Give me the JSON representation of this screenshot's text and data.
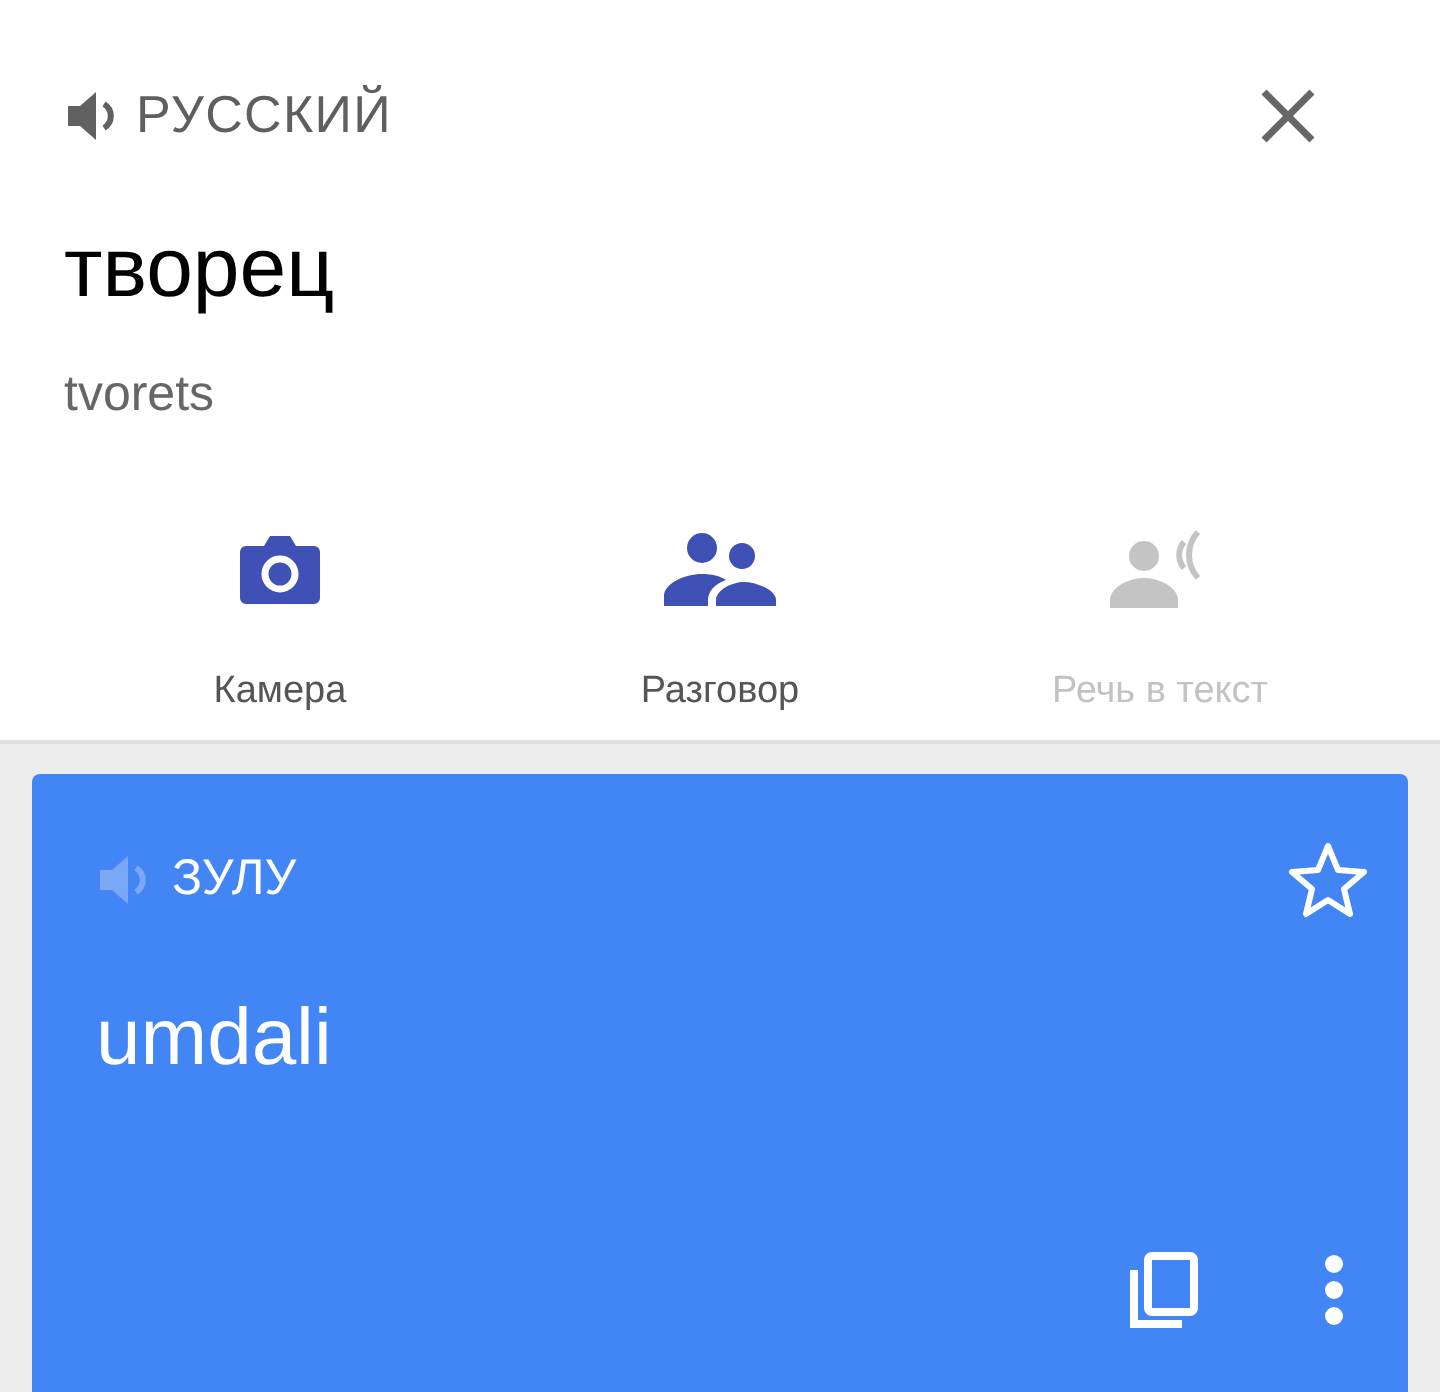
{
  "source": {
    "language": "РУССКИЙ",
    "text": "творец",
    "transliteration": "tvorets"
  },
  "actions": [
    {
      "label": "Камера",
      "kind": "camera",
      "disabled": false
    },
    {
      "label": "Разговор",
      "kind": "conversation",
      "disabled": false
    },
    {
      "label": "Речь в текст",
      "kind": "speech",
      "disabled": true
    }
  ],
  "target": {
    "language": "ЗУЛУ",
    "text": "umdali",
    "starred": false,
    "audio_disabled": true
  }
}
